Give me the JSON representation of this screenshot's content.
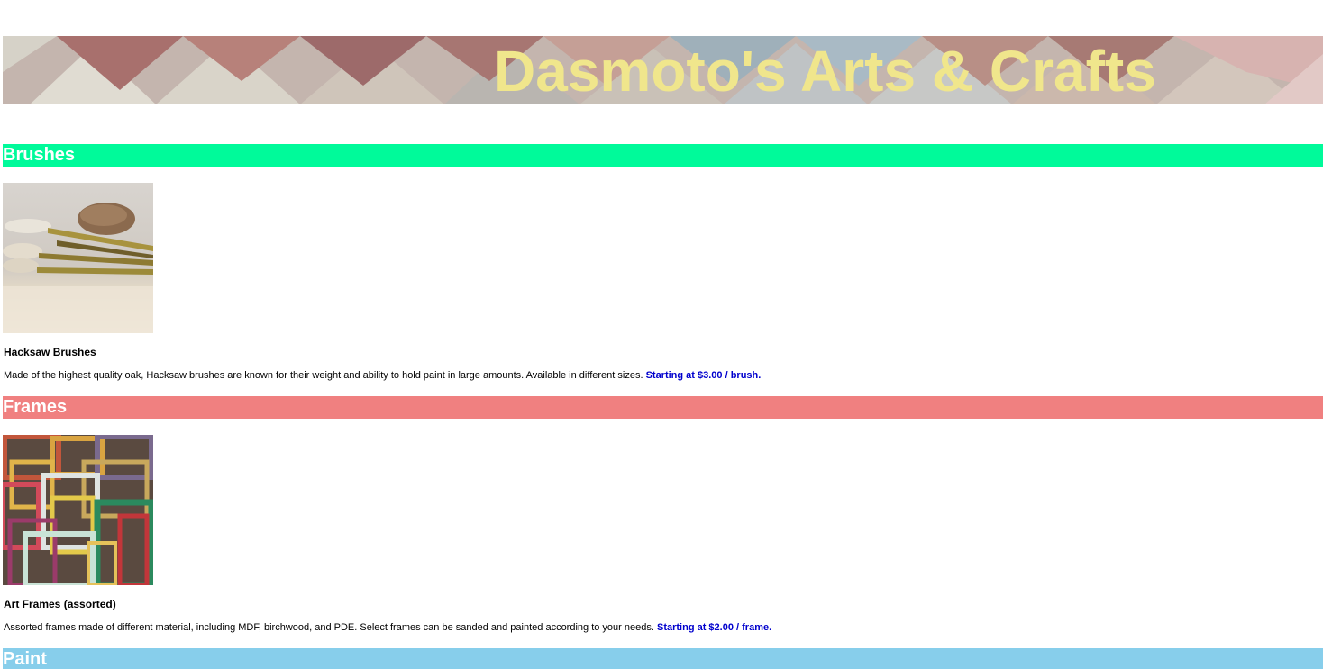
{
  "banner": {
    "title": "Dasmoto's Arts & Crafts"
  },
  "sections": [
    {
      "heading": "Brushes",
      "color": "#00fa9a",
      "product": {
        "image": "brushes-photo",
        "name": "Hacksaw Brushes",
        "description": "Made of the highest quality oak, Hacksaw brushes are known for their weight and ability to hold paint in large amounts. Available in different sizes.",
        "price": "Starting at $3.00 / brush."
      }
    },
    {
      "heading": "Frames",
      "color": "#f08080",
      "product": {
        "image": "frames-photo",
        "name": "Art Frames (assorted)",
        "description": "Assorted frames made of different material, including MDF, birchwood, and PDE. Select frames can be sanded and painted according to your needs.",
        "price": "Starting at $2.00 / frame."
      }
    },
    {
      "heading": "Paint",
      "color": "#87ceeb"
    }
  ],
  "colors": {
    "title_text": "#f0e68c",
    "price_text": "#0000cd",
    "heading_text": "#ffffff"
  }
}
